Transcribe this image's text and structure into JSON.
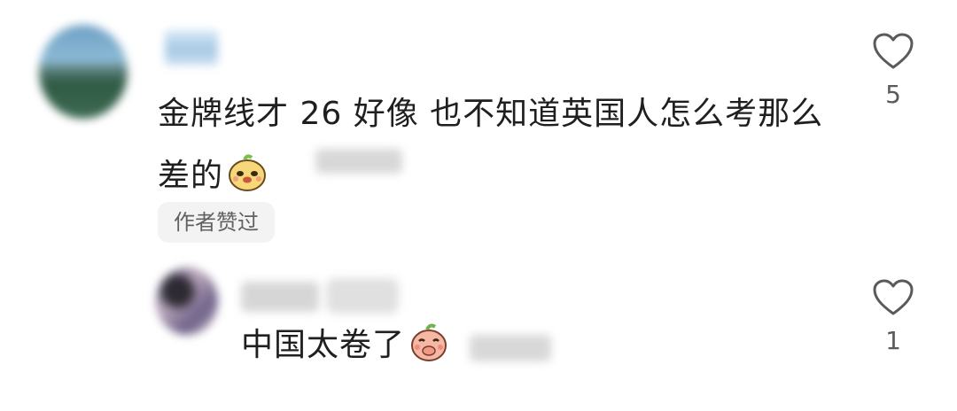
{
  "comment": {
    "text": "金牌线才 26 好像 也不知道英国人怎么考那么差的",
    "emoji": "smug-face-emoji",
    "badge": "作者赞过",
    "likes": "5"
  },
  "reply": {
    "text": "中国太卷了",
    "emoji": "covering-mouth-laugh-emoji",
    "likes": "1"
  },
  "colors": {
    "text": "#1f1f1f",
    "badge_bg": "#f3f3f3",
    "badge_text": "#616161",
    "icon": "#5a5a5a"
  }
}
